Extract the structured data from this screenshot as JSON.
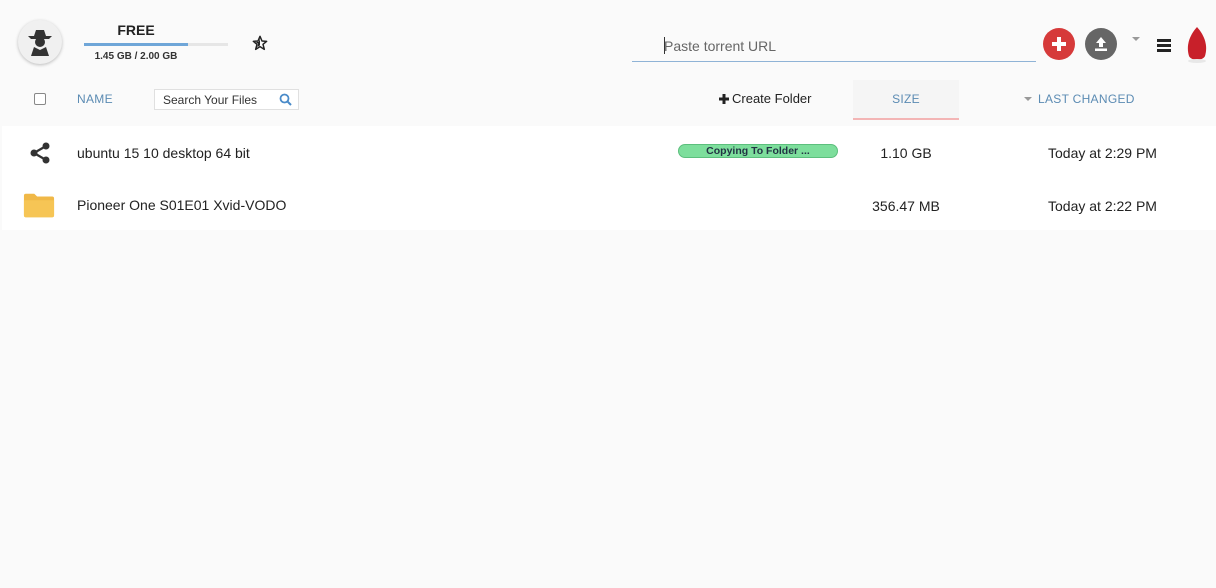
{
  "account": {
    "plan": "FREE",
    "quota_text": "1.45 GB / 2.00 GB",
    "quota_used_fraction": 0.725
  },
  "header": {
    "url_placeholder": "Paste torrent URL",
    "icons": {
      "avatar": "spy-avatar-icon",
      "favorites": "star-icon",
      "add": "plus-icon",
      "upload": "upload-icon",
      "dropdown": "chevron-down-icon",
      "menu": "hamburger-menu-icon",
      "logo": "seedr-logo-icon"
    },
    "colors": {
      "add": "#d63a3a",
      "upload": "#666666",
      "logo": "#c8202a"
    }
  },
  "table": {
    "name_header": "NAME",
    "search_placeholder": "Search Your Files",
    "create_folder_label": "Create Folder",
    "size_header": "SIZE",
    "changed_header": "LAST CHANGED"
  },
  "files": [
    {
      "icon": "share-icon",
      "name": "ubuntu 15 10 desktop 64 bit",
      "status": "Copying To Folder ...",
      "size": "1.10 GB",
      "changed": "Today at 2:29 PM"
    },
    {
      "icon": "folder-icon",
      "name": "Pioneer One S01E01 Xvid-VODO",
      "status": "",
      "size": "356.47 MB",
      "changed": "Today at 2:22 PM"
    }
  ]
}
